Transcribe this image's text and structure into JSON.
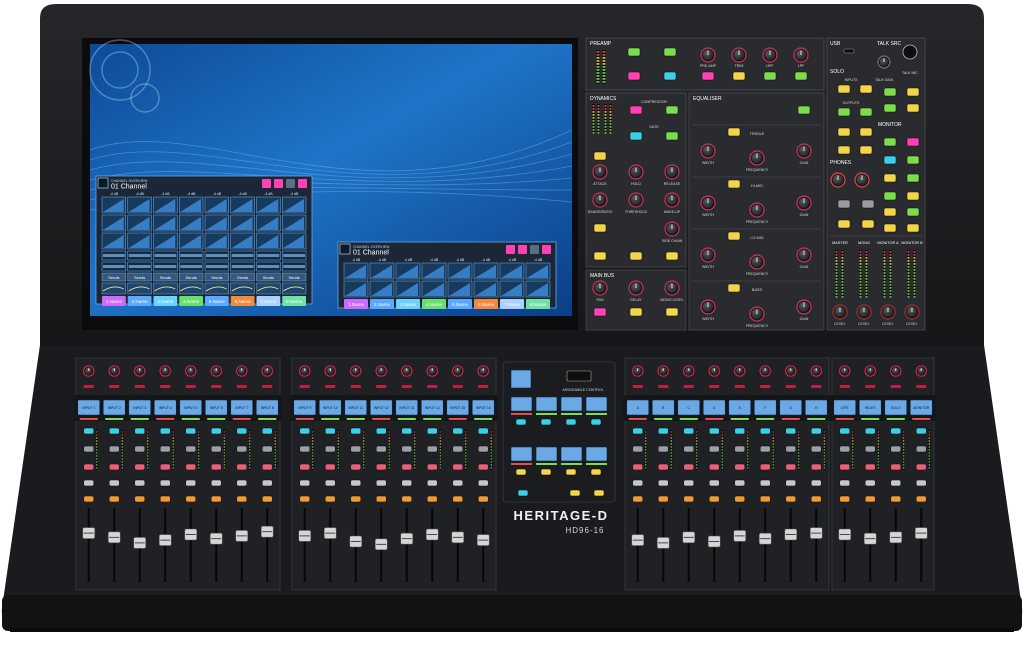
{
  "colors": {
    "body": "#1d1e21",
    "panel": "#2a2b2f",
    "panel_line": "#505258",
    "screen_blue": "#1f74c9",
    "window": "#1b2736",
    "cell_blue": "#3e8fe0",
    "accent_pink": "#ff41b4",
    "green": "#7ddc4e",
    "cyan": "#3bd0e6",
    "yellow": "#f3d54a",
    "red": "#ea4a4a",
    "orange": "#f09a34",
    "strip_lcd": "#6aa8e6"
  },
  "screen": {
    "window_a": {
      "subtitle": "CHANNEL OVERVIEW",
      "title": "01 Channel",
      "sends_label": "Sends",
      "db_label": "-4 dB",
      "names": [
        "1.Name",
        "2.Name",
        "3.Name",
        "4.Name",
        "5.Name",
        "6.Name",
        "7.Name",
        "8.Name"
      ]
    },
    "window_b": {
      "subtitle": "CHANNEL OVERVIEW",
      "title": "01 Channel",
      "db_label": "-4 dB",
      "names": [
        "1.Name",
        "2.Name",
        "3.Name",
        "4.Name",
        "5.Name",
        "6.Name",
        "7.Name",
        "8.Name"
      ]
    },
    "name_colors": [
      "#c96bff",
      "#5aa8ff",
      "#69d3ff",
      "#67e06e",
      "#5aa8ff",
      "#f08a3c",
      "#a9d0ff",
      "#6ee2a6"
    ]
  },
  "preamp": {
    "title": "PREAMP",
    "knobs": [
      "PRE-AMP",
      "TRIM",
      "HPF",
      "LPF"
    ]
  },
  "dynamics": {
    "title": "DYNAMICS",
    "compressor_label": "COMPRESSOR",
    "gate_label": "GATE",
    "knobs": [
      "ATTACK",
      "HOLD",
      "RELEASE",
      "RANGE/RATIO",
      "THRESHOLD",
      "MAKE-UP",
      "SIDE CHAIN"
    ]
  },
  "equaliser": {
    "title": "EQUALISER",
    "bands": [
      {
        "name": "TREBLE",
        "knobs": [
          "WIDTH",
          "FREQUENCY",
          "GAIN"
        ]
      },
      {
        "name": "HI-MID",
        "knobs": [
          "WIDTH",
          "FREQUENCY",
          "GAIN"
        ]
      },
      {
        "name": "LO-MID",
        "knobs": [
          "WIDTH",
          "FREQUENCY",
          "GAIN"
        ]
      },
      {
        "name": "BASS",
        "knobs": [
          "WIDTH",
          "FREQUENCY",
          "GAIN"
        ]
      }
    ]
  },
  "main_bus": {
    "title": "MAIN BUS",
    "knobs": [
      "PAN",
      "DELAY",
      "MONO LEVEL"
    ]
  },
  "right_panel": {
    "usb": "USB",
    "talk_src": "TALK SRC",
    "talk_mic": "TALK MIC",
    "talk_gain": "TALK GAIN",
    "solo": "SOLO",
    "inputs": "INPUTS",
    "outputs": "OUTPUTS",
    "monitor": "MONITOR",
    "phones": "PHONES",
    "meters": [
      "MASTER",
      "MONO",
      "MONITOR A",
      "MONITOR B"
    ],
    "level_knobs": [
      "LEVEL",
      "LEVEL",
      "LEVEL",
      "LEVEL"
    ]
  },
  "surface": {
    "bank_sizes": [
      8,
      8,
      8,
      4
    ],
    "strip_labels": [
      [
        "INPUT 1",
        "INPUT 2",
        "INPUT 3",
        "INPUT 4",
        "INPUT 5",
        "INPUT 6",
        "INPUT 7",
        "INPUT 8"
      ],
      [
        "INPUT 9",
        "INPUT 10",
        "INPUT 11",
        "INPUT 12",
        "INPUT 13",
        "INPUT 14",
        "INPUT 15",
        "INPUT 16"
      ],
      [
        "A",
        "B",
        "C",
        "D",
        "E",
        "F",
        "G",
        "H"
      ],
      [
        "LEFT",
        "RIGHT",
        "SOLO",
        "MONITOR"
      ]
    ],
    "fader_levels": [
      [
        0.72,
        0.66,
        0.58,
        0.62,
        0.7,
        0.64,
        0.68,
        0.74
      ],
      [
        0.68,
        0.72,
        0.6,
        0.56,
        0.64,
        0.7,
        0.66,
        0.62
      ],
      [
        0.62,
        0.58,
        0.66,
        0.6,
        0.68,
        0.64,
        0.7,
        0.72
      ],
      [
        0.7,
        0.64,
        0.66,
        0.72
      ]
    ],
    "center": {
      "assignable_label": "ASSIGNABLE CONTROL",
      "brand": "HERITAGE-D",
      "model": "HD96-16"
    }
  }
}
